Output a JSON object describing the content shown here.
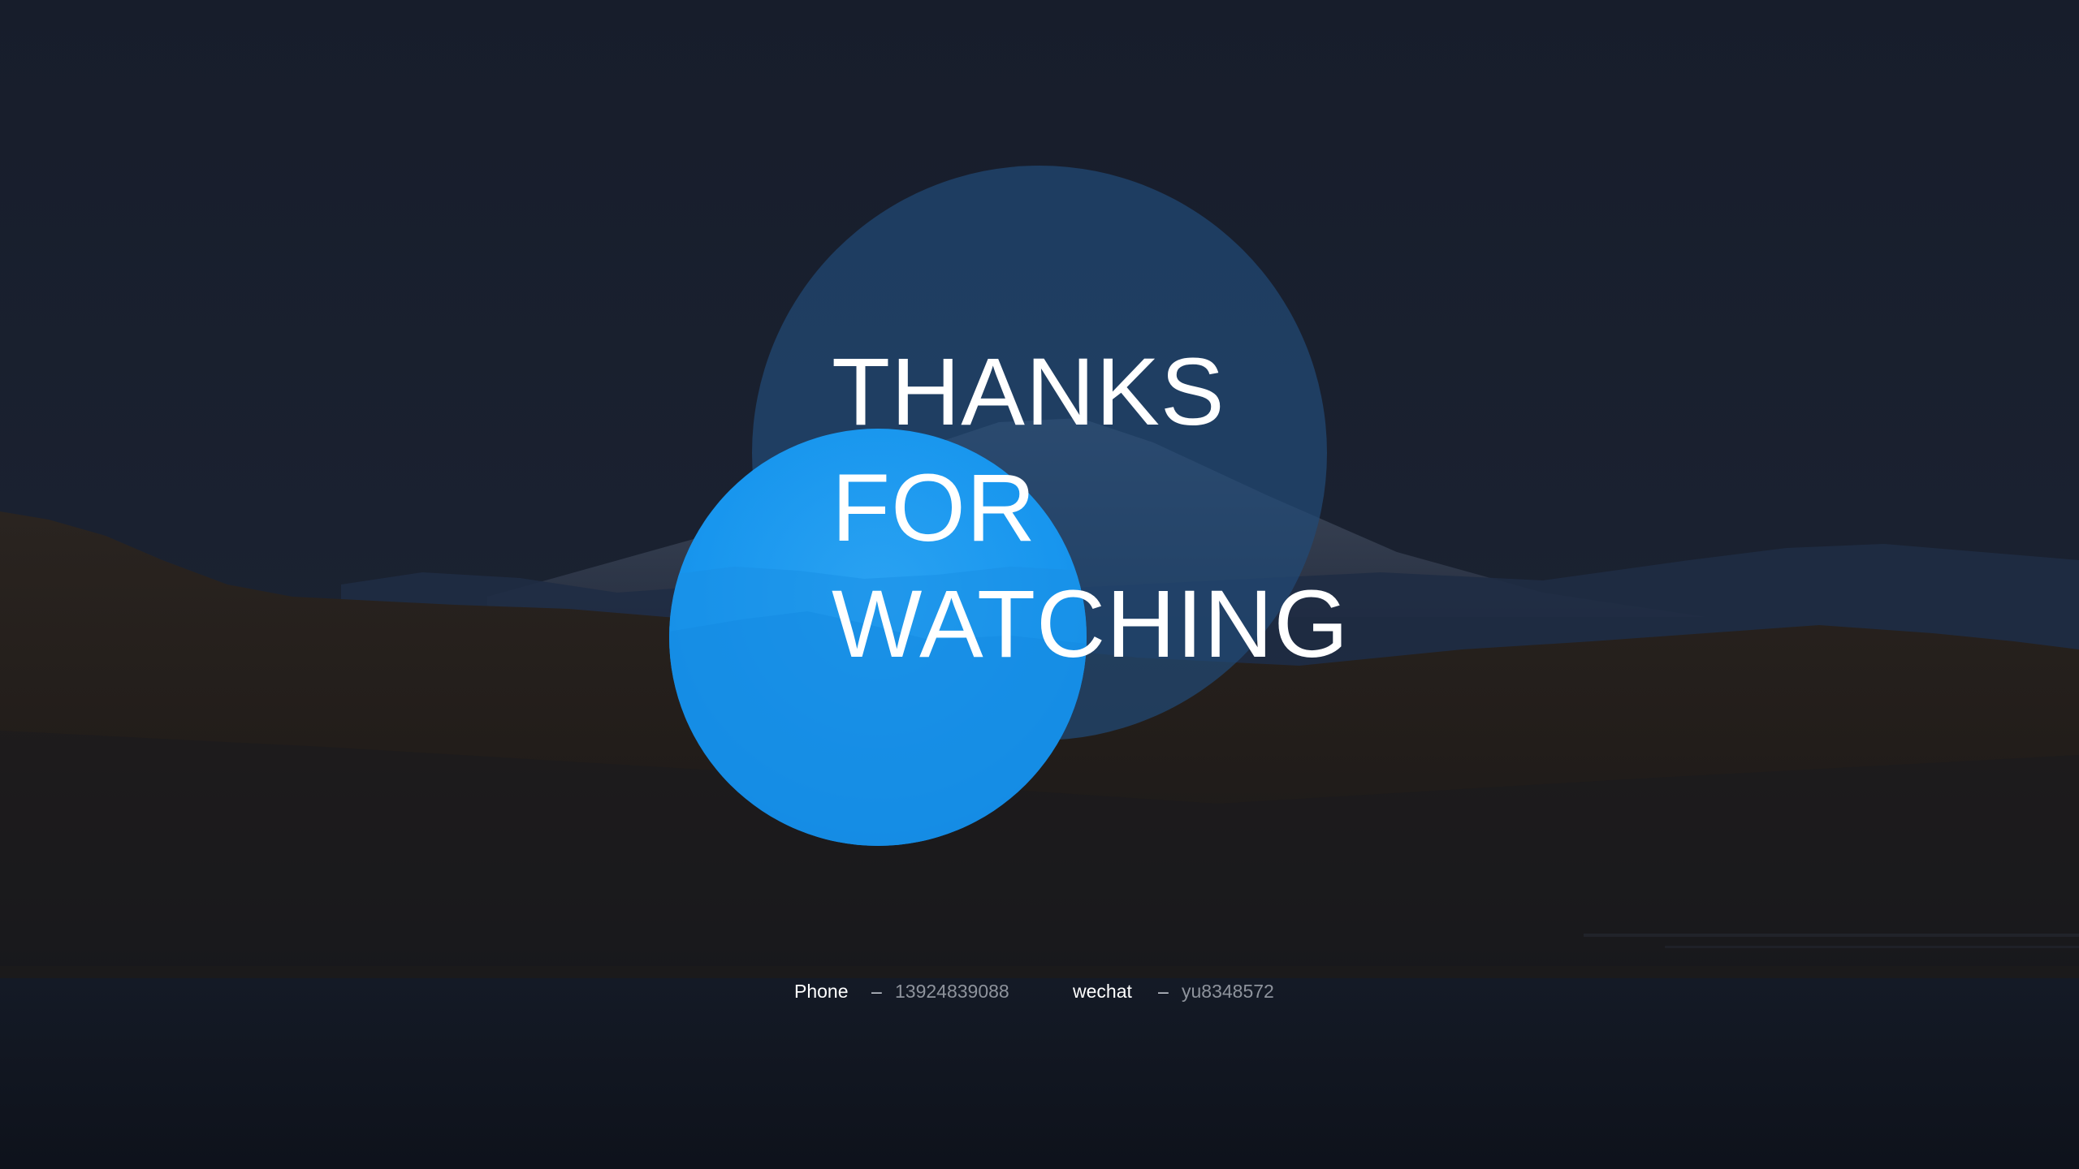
{
  "title": {
    "line1": "THANKS",
    "line2": "FOR",
    "line3": "WATCHING"
  },
  "contact": {
    "phone_label": "Phone",
    "phone_dash": "–",
    "phone_value": "13924839088",
    "wechat_label": "wechat",
    "wechat_dash": "–",
    "wechat_value": "yu8348572"
  },
  "colors": {
    "background": "#161c28",
    "large_circle": "#214a76",
    "small_circle": "#1896ee",
    "title_text": "#ffffff"
  }
}
